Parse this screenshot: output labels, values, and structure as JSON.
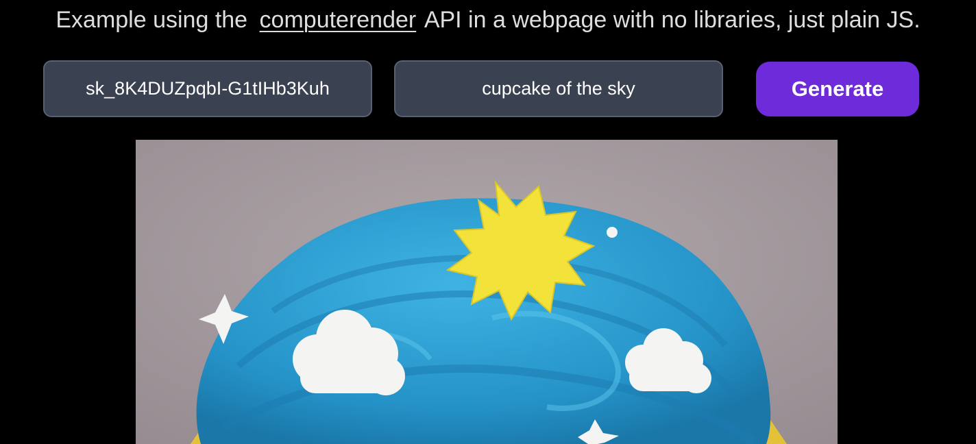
{
  "intro": {
    "before_link": "Example using the",
    "link_text": "computerender",
    "after_link": "API in a webpage with no libraries, just plain JS."
  },
  "form": {
    "api_key_value": "sk_8K4DUZpqbI-G1tIHb3Kuh",
    "prompt_value": "cupcake of the sky",
    "generate_label": "Generate"
  },
  "colors": {
    "background": "#000000",
    "input_bg": "#3a4151",
    "button_bg": "#6d2bd9",
    "frosting": "#2ca0d3",
    "sun": "#f2e23a"
  },
  "result": {
    "icons": [
      "sun-icon",
      "cloud-icon",
      "star-icon"
    ]
  }
}
